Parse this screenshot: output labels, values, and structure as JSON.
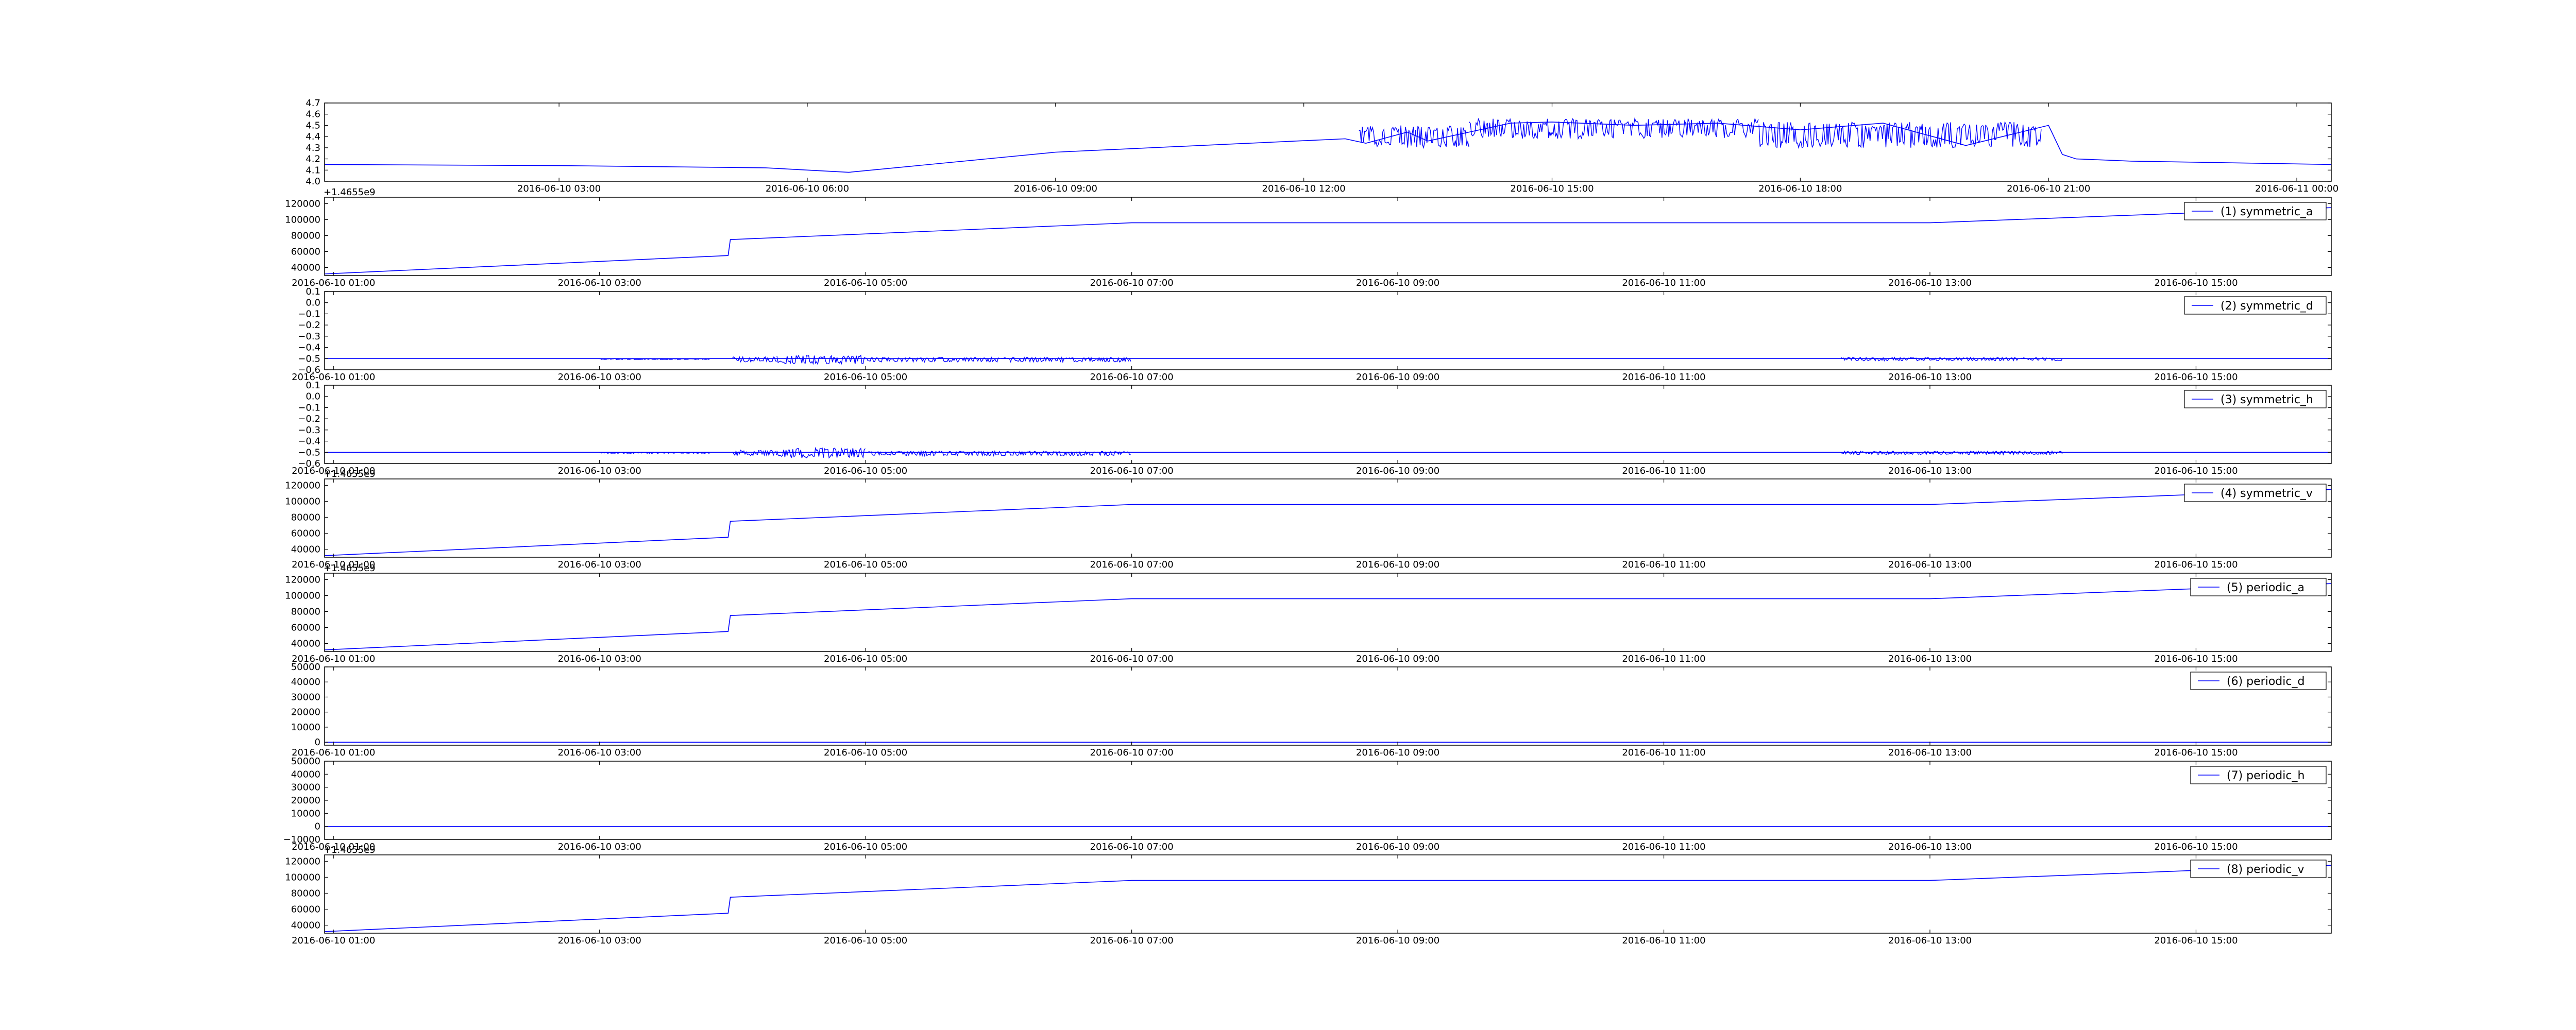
{
  "chart_data": [
    {
      "type": "line",
      "title": "",
      "xlabel": "",
      "ylabel": "",
      "x_ticks": [
        "2016-06-10 03:00",
        "2016-06-10 06:00",
        "2016-06-10 09:00",
        "2016-06-10 12:00",
        "2016-06-10 15:00",
        "2016-06-10 18:00",
        "2016-06-10 21:00",
        "2016-06-11 00:00"
      ],
      "xlim": [
        "2016-06-10 00:10",
        "2016-06-11 00:25"
      ],
      "y_ticks": [
        "4.0",
        "4.1",
        "4.2",
        "4.3",
        "4.4",
        "4.5",
        "4.6",
        "4.7"
      ],
      "ylim": [
        4.0,
        4.7
      ],
      "y_offset_label": "",
      "legend": "",
      "legend_position": "",
      "grid": false,
      "series": [
        {
          "x": [
            "2016-06-10 00:10",
            "2016-06-10 03:00",
            "2016-06-10 05:30",
            "2016-06-10 06:30",
            "2016-06-10 09:00",
            "2016-06-10 12:30",
            "2016-06-10 12:45",
            "2016-06-10 13:15",
            "2016-06-10 13:30",
            "2016-06-10 14:30",
            "2016-06-10 15:00",
            "2016-06-10 16:00",
            "2016-06-10 17:00",
            "2016-06-10 18:00",
            "2016-06-10 19:00",
            "2016-06-10 20:00",
            "2016-06-10 21:00",
            "2016-06-10 21:10",
            "2016-06-10 21:20",
            "2016-06-10 21:40",
            "2016-06-10 22:00",
            "2016-06-11 00:25"
          ],
          "values": [
            4.15,
            4.14,
            4.12,
            4.08,
            4.26,
            4.38,
            4.34,
            4.44,
            4.36,
            4.52,
            4.53,
            4.5,
            4.52,
            4.46,
            4.52,
            4.32,
            4.5,
            4.24,
            4.2,
            4.19,
            4.18,
            4.15
          ],
          "bursts": [
            {
              "x_from": "2016-06-10 12:40",
              "x_to": "2016-06-10 14:00",
              "low": 4.3,
              "high": 4.5
            },
            {
              "x_from": "2016-06-10 14:00",
              "x_to": "2016-06-10 17:30",
              "low": 4.38,
              "high": 4.56
            },
            {
              "x_from": "2016-06-10 17:30",
              "x_to": "2016-06-10 20:55",
              "low": 4.3,
              "high": 4.53
            }
          ]
        }
      ]
    },
    {
      "type": "line",
      "title": "",
      "xlabel": "",
      "ylabel": "",
      "x_ticks": [
        "2016-06-10 01:00",
        "2016-06-10 03:00",
        "2016-06-10 05:00",
        "2016-06-10 07:00",
        "2016-06-10 09:00",
        "2016-06-10 11:00",
        "2016-06-10 13:00",
        "2016-06-10 15:00"
      ],
      "xlim": [
        "2016-06-10 00:56",
        "2016-06-10 16:01"
      ],
      "y_ticks": [
        "40000",
        "60000",
        "80000",
        "100000",
        "120000"
      ],
      "ylim": [
        30000,
        128000
      ],
      "y_offset_label": "+1.4655e9",
      "legend": "(1) symmetric_a",
      "legend_position": "upper right",
      "grid": false,
      "series": [
        {
          "name": "(1) symmetric_a",
          "x": [
            "2016-06-10 00:56",
            "2016-06-10 03:58",
            "2016-06-10 03:59",
            "2016-06-10 07:00",
            "2016-06-10 11:00",
            "2016-06-10 13:00",
            "2016-06-10 16:01"
          ],
          "values": [
            32000,
            55000,
            75000,
            96000,
            96000,
            96000,
            115000
          ],
          "bursts": []
        }
      ]
    },
    {
      "type": "line",
      "title": "",
      "xlabel": "",
      "ylabel": "",
      "x_ticks": [
        "2016-06-10 01:00",
        "2016-06-10 03:00",
        "2016-06-10 05:00",
        "2016-06-10 07:00",
        "2016-06-10 09:00",
        "2016-06-10 11:00",
        "2016-06-10 13:00",
        "2016-06-10 15:00"
      ],
      "xlim": [
        "2016-06-10 00:56",
        "2016-06-10 16:01"
      ],
      "y_ticks": [
        "−0.6",
        "−0.5",
        "−0.4",
        "−0.3",
        "−0.2",
        "−0.1",
        "0.0",
        "0.1"
      ],
      "ylim": [
        -0.6,
        0.1
      ],
      "y_offset_label": "",
      "legend": "(2) symmetric_d",
      "legend_position": "upper right",
      "grid": false,
      "series": [
        {
          "name": "(2) symmetric_d",
          "x": [
            "2016-06-10 00:56",
            "2016-06-10 16:01"
          ],
          "values": [
            -0.5,
            -0.5
          ],
          "bursts": [
            {
              "x_from": "2016-06-10 03:00",
              "x_to": "2016-06-10 03:50",
              "low": -0.51,
              "high": -0.5
            },
            {
              "x_from": "2016-06-10 04:00",
              "x_to": "2016-06-10 04:20",
              "low": -0.53,
              "high": -0.48
            },
            {
              "x_from": "2016-06-10 04:20",
              "x_to": "2016-06-10 05:00",
              "low": -0.55,
              "high": -0.47
            },
            {
              "x_from": "2016-06-10 05:00",
              "x_to": "2016-06-10 07:00",
              "low": -0.53,
              "high": -0.49
            },
            {
              "x_from": "2016-06-10 12:20",
              "x_to": "2016-06-10 14:00",
              "low": -0.52,
              "high": -0.49
            }
          ]
        }
      ]
    },
    {
      "type": "line",
      "title": "",
      "xlabel": "",
      "ylabel": "",
      "x_ticks": [
        "2016-06-10 01:00",
        "2016-06-10 03:00",
        "2016-06-10 05:00",
        "2016-06-10 07:00",
        "2016-06-10 09:00",
        "2016-06-10 11:00",
        "2016-06-10 13:00",
        "2016-06-10 15:00"
      ],
      "xlim": [
        "2016-06-10 00:56",
        "2016-06-10 16:01"
      ],
      "y_ticks": [
        "−0.6",
        "−0.5",
        "−0.4",
        "−0.3",
        "−0.2",
        "−0.1",
        "0.0",
        "0.1"
      ],
      "ylim": [
        -0.6,
        0.1
      ],
      "y_offset_label": "",
      "legend": "(3) symmetric_h",
      "legend_position": "upper right",
      "grid": false,
      "series": [
        {
          "name": "(3) symmetric_h",
          "x": [
            "2016-06-10 00:56",
            "2016-06-10 16:01"
          ],
          "values": [
            -0.5,
            -0.5
          ],
          "bursts": [
            {
              "x_from": "2016-06-10 03:00",
              "x_to": "2016-06-10 03:50",
              "low": -0.51,
              "high": -0.5
            },
            {
              "x_from": "2016-06-10 04:00",
              "x_to": "2016-06-10 04:20",
              "low": -0.53,
              "high": -0.48
            },
            {
              "x_from": "2016-06-10 04:20",
              "x_to": "2016-06-10 05:00",
              "low": -0.55,
              "high": -0.46
            },
            {
              "x_from": "2016-06-10 05:00",
              "x_to": "2016-06-10 07:00",
              "low": -0.53,
              "high": -0.49
            },
            {
              "x_from": "2016-06-10 12:20",
              "x_to": "2016-06-10 14:00",
              "low": -0.52,
              "high": -0.49
            }
          ]
        }
      ]
    },
    {
      "type": "line",
      "title": "",
      "xlabel": "",
      "ylabel": "",
      "x_ticks": [
        "2016-06-10 01:00",
        "2016-06-10 03:00",
        "2016-06-10 05:00",
        "2016-06-10 07:00",
        "2016-06-10 09:00",
        "2016-06-10 11:00",
        "2016-06-10 13:00",
        "2016-06-10 15:00"
      ],
      "xlim": [
        "2016-06-10 00:56",
        "2016-06-10 16:01"
      ],
      "y_ticks": [
        "40000",
        "60000",
        "80000",
        "100000",
        "120000"
      ],
      "ylim": [
        30000,
        128000
      ],
      "y_offset_label": "+1.4655e9",
      "legend": "(4) symmetric_v",
      "legend_position": "upper right",
      "grid": false,
      "series": [
        {
          "name": "(4) symmetric_v",
          "x": [
            "2016-06-10 00:56",
            "2016-06-10 03:58",
            "2016-06-10 03:59",
            "2016-06-10 07:00",
            "2016-06-10 11:00",
            "2016-06-10 13:00",
            "2016-06-10 16:01"
          ],
          "values": [
            32000,
            55000,
            75000,
            96000,
            96000,
            96000,
            115000
          ],
          "bursts": []
        }
      ]
    },
    {
      "type": "line",
      "title": "",
      "xlabel": "",
      "ylabel": "",
      "x_ticks": [
        "2016-06-10 01:00",
        "2016-06-10 03:00",
        "2016-06-10 05:00",
        "2016-06-10 07:00",
        "2016-06-10 09:00",
        "2016-06-10 11:00",
        "2016-06-10 13:00",
        "2016-06-10 15:00"
      ],
      "xlim": [
        "2016-06-10 00:56",
        "2016-06-10 16:01"
      ],
      "y_ticks": [
        "40000",
        "60000",
        "80000",
        "100000",
        "120000"
      ],
      "ylim": [
        30000,
        128000
      ],
      "y_offset_label": "+1.4655e9",
      "legend": "(5) periodic_a",
      "legend_position": "upper right",
      "grid": false,
      "series": [
        {
          "name": "(5) periodic_a",
          "x": [
            "2016-06-10 00:56",
            "2016-06-10 03:58",
            "2016-06-10 03:59",
            "2016-06-10 07:00",
            "2016-06-10 11:00",
            "2016-06-10 13:00",
            "2016-06-10 16:01"
          ],
          "values": [
            32000,
            55000,
            75000,
            96000,
            96000,
            96000,
            115000
          ],
          "bursts": []
        }
      ]
    },
    {
      "type": "line",
      "title": "",
      "xlabel": "",
      "ylabel": "",
      "x_ticks": [
        "2016-06-10 01:00",
        "2016-06-10 03:00",
        "2016-06-10 05:00",
        "2016-06-10 07:00",
        "2016-06-10 09:00",
        "2016-06-10 11:00",
        "2016-06-10 13:00",
        "2016-06-10 15:00"
      ],
      "xlim": [
        "2016-06-10 00:56",
        "2016-06-10 16:01"
      ],
      "y_ticks": [
        "0",
        "10000",
        "20000",
        "30000",
        "40000",
        "50000"
      ],
      "ylim": [
        -2000,
        50000
      ],
      "y_offset_label": "",
      "legend": "(6) periodic_d",
      "legend_position": "upper right",
      "grid": false,
      "series": [
        {
          "name": "(6) periodic_d",
          "x": [
            "2016-06-10 00:56",
            "2016-06-10 16:01"
          ],
          "values": [
            0,
            0
          ],
          "bursts": []
        }
      ]
    },
    {
      "type": "line",
      "title": "",
      "xlabel": "",
      "ylabel": "",
      "x_ticks": [
        "2016-06-10 01:00",
        "2016-06-10 03:00",
        "2016-06-10 05:00",
        "2016-06-10 07:00",
        "2016-06-10 09:00",
        "2016-06-10 11:00",
        "2016-06-10 13:00",
        "2016-06-10 15:00"
      ],
      "xlim": [
        "2016-06-10 00:56",
        "2016-06-10 16:01"
      ],
      "y_ticks": [
        "−10000",
        "0",
        "10000",
        "20000",
        "30000",
        "40000",
        "50000"
      ],
      "ylim": [
        -10000,
        50000
      ],
      "y_offset_label": "",
      "legend": "(7) periodic_h",
      "legend_position": "upper right",
      "grid": false,
      "series": [
        {
          "name": "(7) periodic_h",
          "x": [
            "2016-06-10 00:56",
            "2016-06-10 16:01"
          ],
          "values": [
            0,
            0
          ],
          "bursts": []
        }
      ]
    },
    {
      "type": "line",
      "title": "",
      "xlabel": "",
      "ylabel": "",
      "x_ticks": [
        "2016-06-10 01:00",
        "2016-06-10 03:00",
        "2016-06-10 05:00",
        "2016-06-10 07:00",
        "2016-06-10 09:00",
        "2016-06-10 11:00",
        "2016-06-10 13:00",
        "2016-06-10 15:00"
      ],
      "xlim": [
        "2016-06-10 00:56",
        "2016-06-10 16:01"
      ],
      "y_ticks": [
        "40000",
        "60000",
        "80000",
        "100000",
        "120000"
      ],
      "ylim": [
        30000,
        128000
      ],
      "y_offset_label": "+1.4655e9",
      "legend": "(8) periodic_v",
      "legend_position": "upper right",
      "grid": false,
      "series": [
        {
          "name": "(8) periodic_v",
          "x": [
            "2016-06-10 00:56",
            "2016-06-10 03:58",
            "2016-06-10 03:59",
            "2016-06-10 07:00",
            "2016-06-10 11:00",
            "2016-06-10 13:00",
            "2016-06-10 16:01"
          ],
          "values": [
            32000,
            55000,
            75000,
            96000,
            96000,
            96000,
            115000
          ],
          "bursts": []
        }
      ]
    }
  ],
  "colors": {
    "line": "#0000ff",
    "axes": "#000000",
    "background": "#ffffff"
  }
}
